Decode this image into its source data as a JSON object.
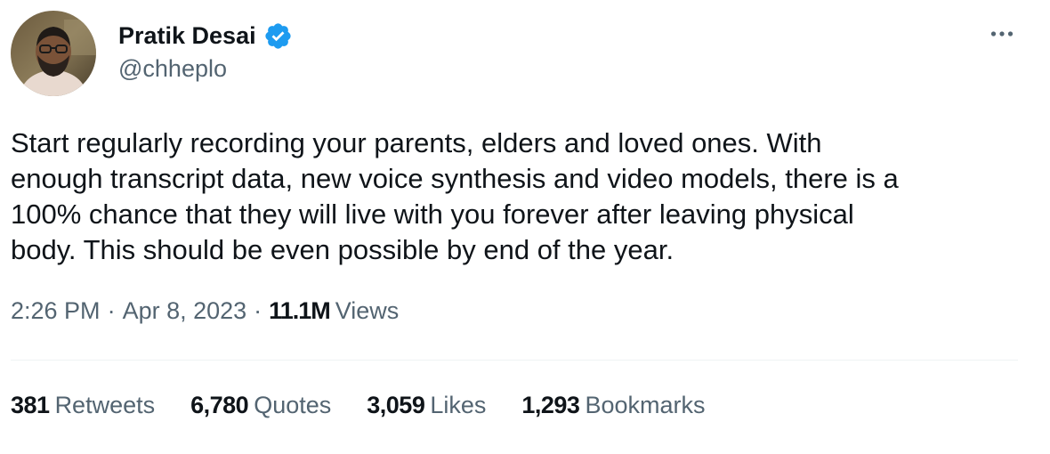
{
  "author": {
    "display_name": "Pratik Desai",
    "handle": "@chheplo",
    "verified": true,
    "verified_color": "#1d9bf0"
  },
  "tweet": {
    "text_lines": [
      "Start regularly recording your parents, elders and loved ones. With",
      "enough transcript data, new voice synthesis and video models, there is a",
      "100% chance that they will live with you forever after leaving physical",
      "body. This should be even possible by end of the year."
    ]
  },
  "meta": {
    "time": "2:26 PM",
    "separator": "·",
    "date": "Apr 8, 2023",
    "views_count": "11.1M",
    "views_label": "Views"
  },
  "stats": {
    "retweets": {
      "count": "381",
      "label": "Retweets"
    },
    "quotes": {
      "count": "6,780",
      "label": "Quotes"
    },
    "likes": {
      "count": "3,059",
      "label": "Likes"
    },
    "bookmarks": {
      "count": "1,293",
      "label": "Bookmarks"
    }
  },
  "icons": {
    "more": "more-horizontal-icon",
    "verified": "verified-badge-icon"
  },
  "colors": {
    "primary_text": "#0f1419",
    "secondary_text": "#536471",
    "divider": "#eff3f4"
  }
}
